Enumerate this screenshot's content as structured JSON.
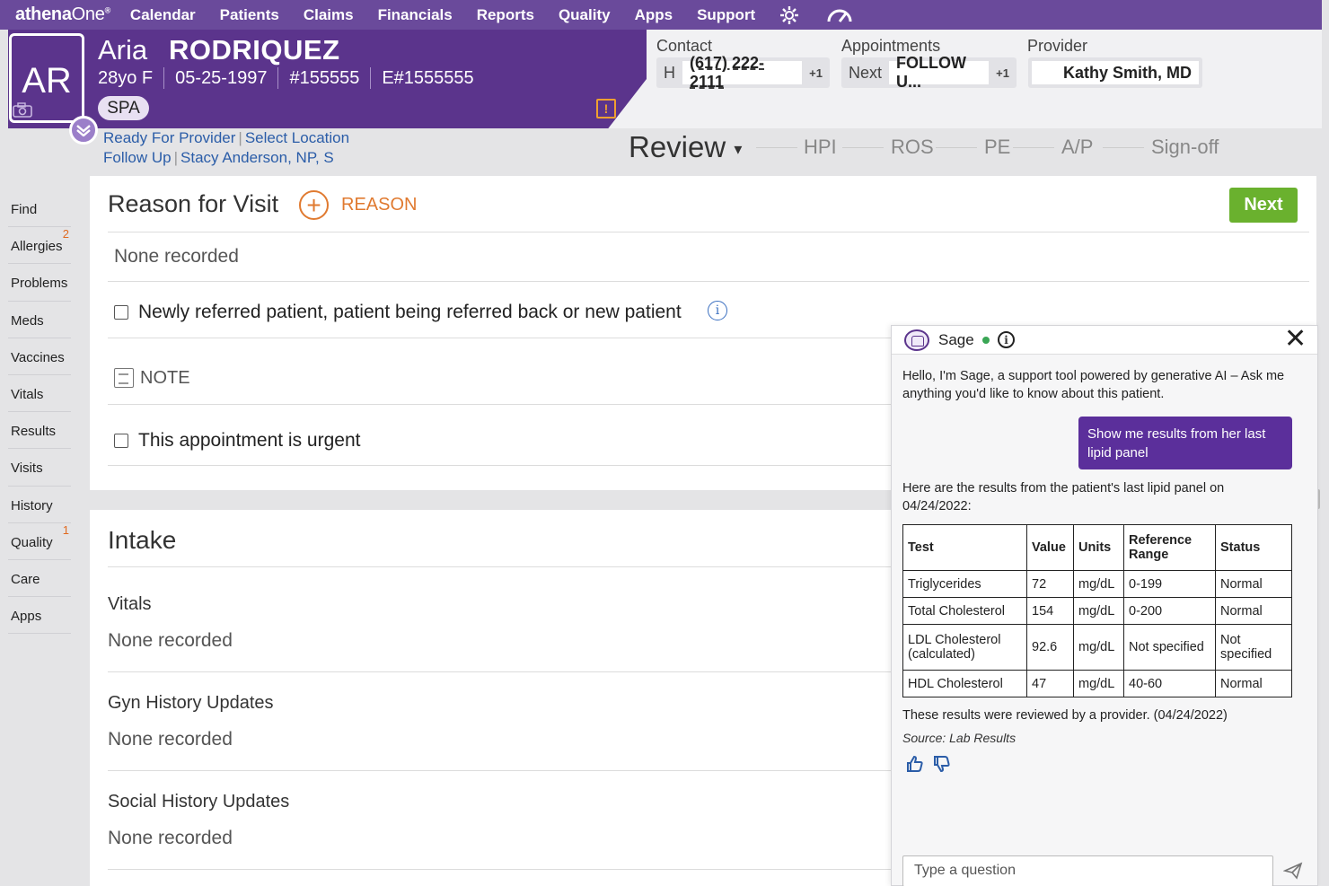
{
  "nav": {
    "logo_bold": "athena",
    "logo_light": "One",
    "logo_mark": "®",
    "items": [
      "Calendar",
      "Patients",
      "Claims",
      "Financials",
      "Reports",
      "Quality",
      "Apps",
      "Support"
    ],
    "icons": [
      "gear-icon",
      "gauge-icon"
    ]
  },
  "patient": {
    "initials": "AR",
    "first_name": "Aria",
    "last_name": "RODRIQUEZ",
    "age_sex": "28yo F",
    "dob": "05-25-1997",
    "mrn": "#155555",
    "enterprise_id": "E#1555555",
    "tag": "SPA",
    "alert_icon": "!"
  },
  "contact": {
    "label": "Contact",
    "type": "H",
    "phone": "(617) 222-2111",
    "more": "+1"
  },
  "appointments": {
    "label": "Appointments",
    "prefix": "Next",
    "value": "FOLLOW U...",
    "more": "+1"
  },
  "provider": {
    "label": "Provider",
    "name": "Kathy Smith, MD"
  },
  "status_links": {
    "ready": "Ready For Provider",
    "location": "Select Location",
    "follow_up": "Follow Up",
    "staff": "Stacy Anderson, NP, S",
    "separator": "|"
  },
  "workflow": {
    "current": "Review",
    "dropdown": "▾",
    "steps": [
      "HPI",
      "ROS",
      "PE",
      "A/P",
      "Sign-off"
    ]
  },
  "sidebar": {
    "items": [
      {
        "label": "Find",
        "badge": ""
      },
      {
        "label": "Allergies",
        "badge": "2"
      },
      {
        "label": "Problems",
        "badge": ""
      },
      {
        "label": "Meds",
        "badge": ""
      },
      {
        "label": "Vaccines",
        "badge": ""
      },
      {
        "label": "Vitals",
        "badge": ""
      },
      {
        "label": "Results",
        "badge": ""
      },
      {
        "label": "Visits",
        "badge": ""
      },
      {
        "label": "History",
        "badge": ""
      },
      {
        "label": "Quality",
        "badge": "1"
      },
      {
        "label": "Care",
        "badge": ""
      },
      {
        "label": "Apps",
        "badge": ""
      }
    ]
  },
  "reason": {
    "title": "Reason for Visit",
    "add_label": "REASON",
    "add_icon": "+",
    "next_button": "Next",
    "empty": "None recorded",
    "new_patient_label": "Newly referred patient, patient being referred back or new patient",
    "info_icon": "i",
    "note_label": "NOTE",
    "urgent_label": "This appointment is urgent"
  },
  "intake": {
    "title": "Intake",
    "sections": [
      {
        "title": "Vitals",
        "value": "None recorded"
      },
      {
        "title": "Gyn History Updates",
        "value": "None recorded"
      },
      {
        "title": "Social History Updates",
        "value": "None recorded"
      }
    ]
  },
  "sage": {
    "name": "Sage",
    "info_icon": "i",
    "close_icon": "✕",
    "greeting": "Hello, I'm Sage, a support tool powered by generative AI – Ask me anything you'd like to know about this patient.",
    "user_prompt": "Show me results from her last lipid panel",
    "response_intro": "Here are the results from the patient's last lipid panel on 04/24/2022:",
    "table_headers": [
      "Test",
      "Value",
      "Units",
      "Reference Range",
      "Status"
    ],
    "table_rows": [
      [
        "Triglycerides",
        "72",
        "mg/dL",
        "0-199",
        "Normal"
      ],
      [
        "Total Cholesterol",
        "154",
        "mg/dL",
        "0-200",
        "Normal"
      ],
      [
        "LDL Cholesterol (calculated)",
        "92.6",
        "mg/dL",
        "Not specified",
        "Not specified"
      ],
      [
        "HDL Cholesterol",
        "47",
        "mg/dL",
        "40-60",
        "Normal"
      ]
    ],
    "reviewed_note": "These results were reviewed by a provider. (04/24/2022)",
    "source": "Source: Lab Results",
    "input_placeholder": "Type a question",
    "send_icon": "➢"
  }
}
